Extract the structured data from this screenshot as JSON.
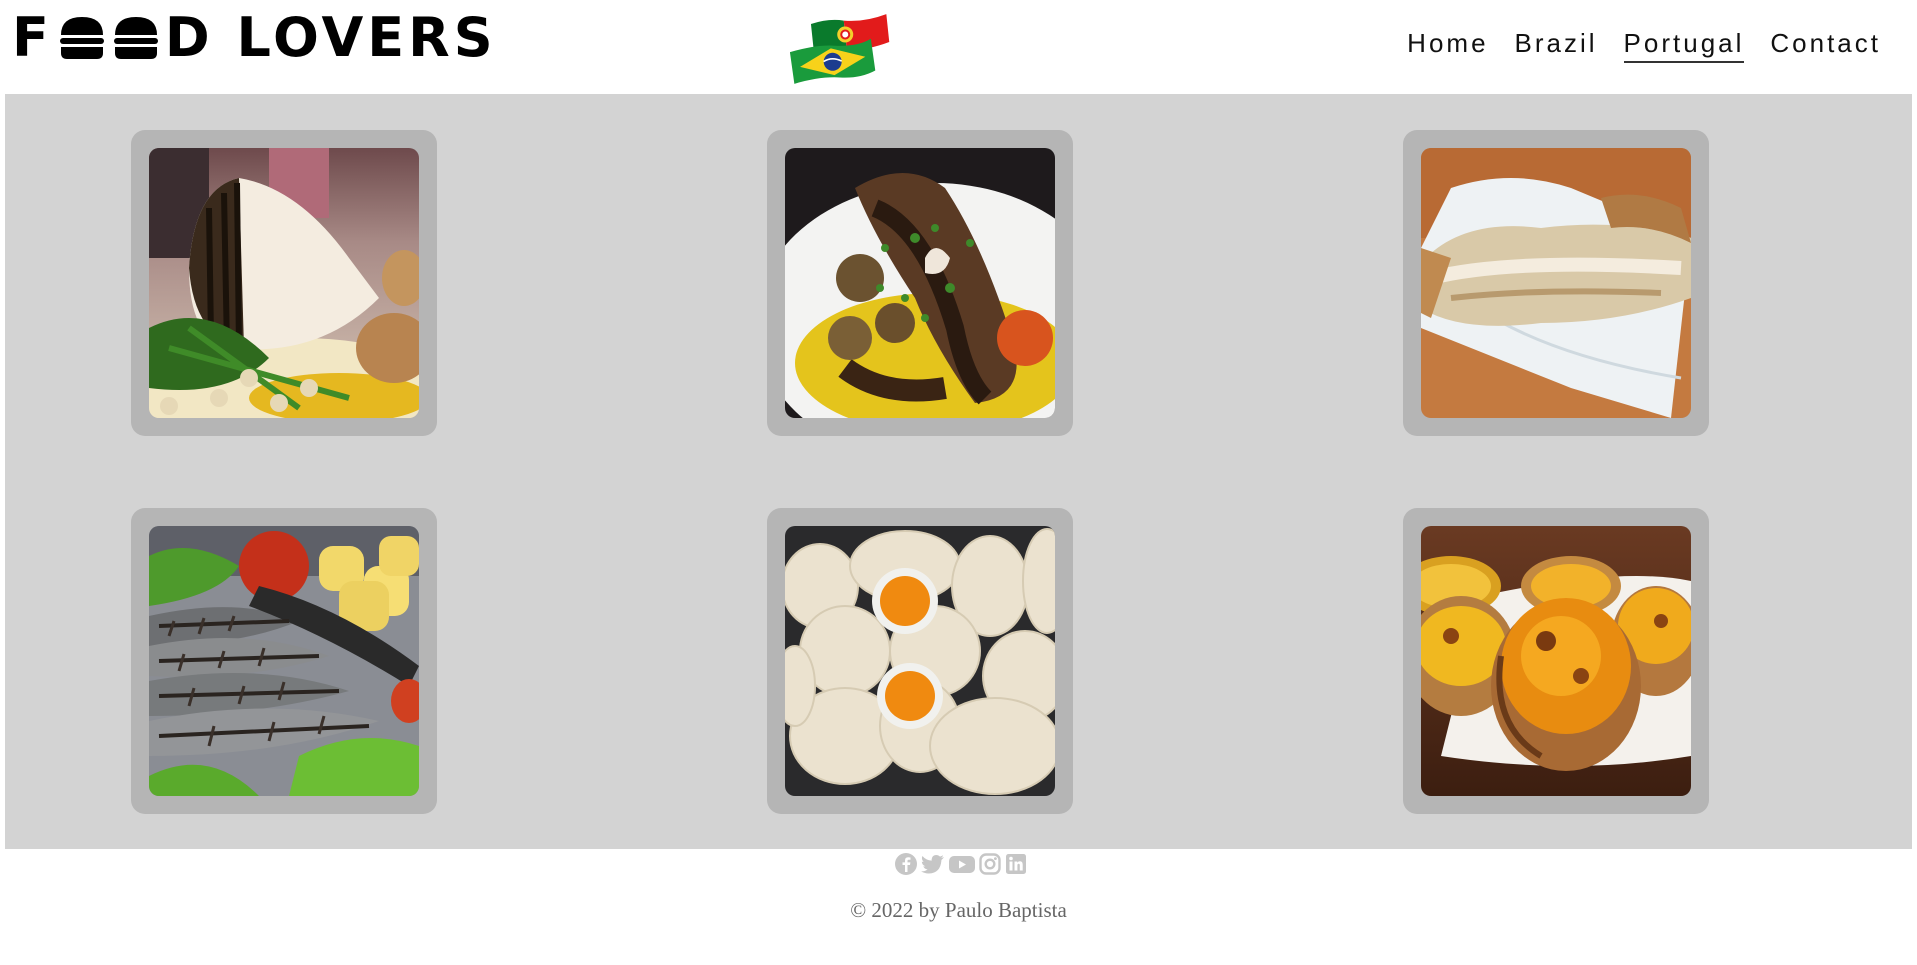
{
  "header": {
    "logo_text_a": "F",
    "logo_text_b": "D LOVERS",
    "logo_icons": [
      "burger-icon",
      "burger-icon"
    ],
    "flags": [
      "portugal-flag",
      "brazil-flag"
    ]
  },
  "nav": {
    "items": [
      {
        "label": "Home",
        "active": false
      },
      {
        "label": "Brazil",
        "active": false
      },
      {
        "label": "Portugal",
        "active": true
      },
      {
        "label": "Contact",
        "active": false
      }
    ]
  },
  "gallery": {
    "images": [
      {
        "name": "grilled-cod-photo"
      },
      {
        "name": "grilled-octopus-photo"
      },
      {
        "name": "pastry-on-napkin-photo"
      },
      {
        "name": "grilled-sardines-photo"
      },
      {
        "name": "egg-yolk-pastries-photo"
      },
      {
        "name": "custard-tarts-photo"
      }
    ]
  },
  "footer": {
    "social_icons": [
      "facebook-icon",
      "twitter-icon",
      "youtube-icon",
      "instagram-icon",
      "linkedin-icon"
    ],
    "copyright": "© 2022 by Paulo Baptista"
  },
  "colors": {
    "gallery_bg": "#d3d3d3",
    "card_bg": "#b5b5b5",
    "social_icon": "#c6c6c6",
    "footer_text": "#666666"
  }
}
